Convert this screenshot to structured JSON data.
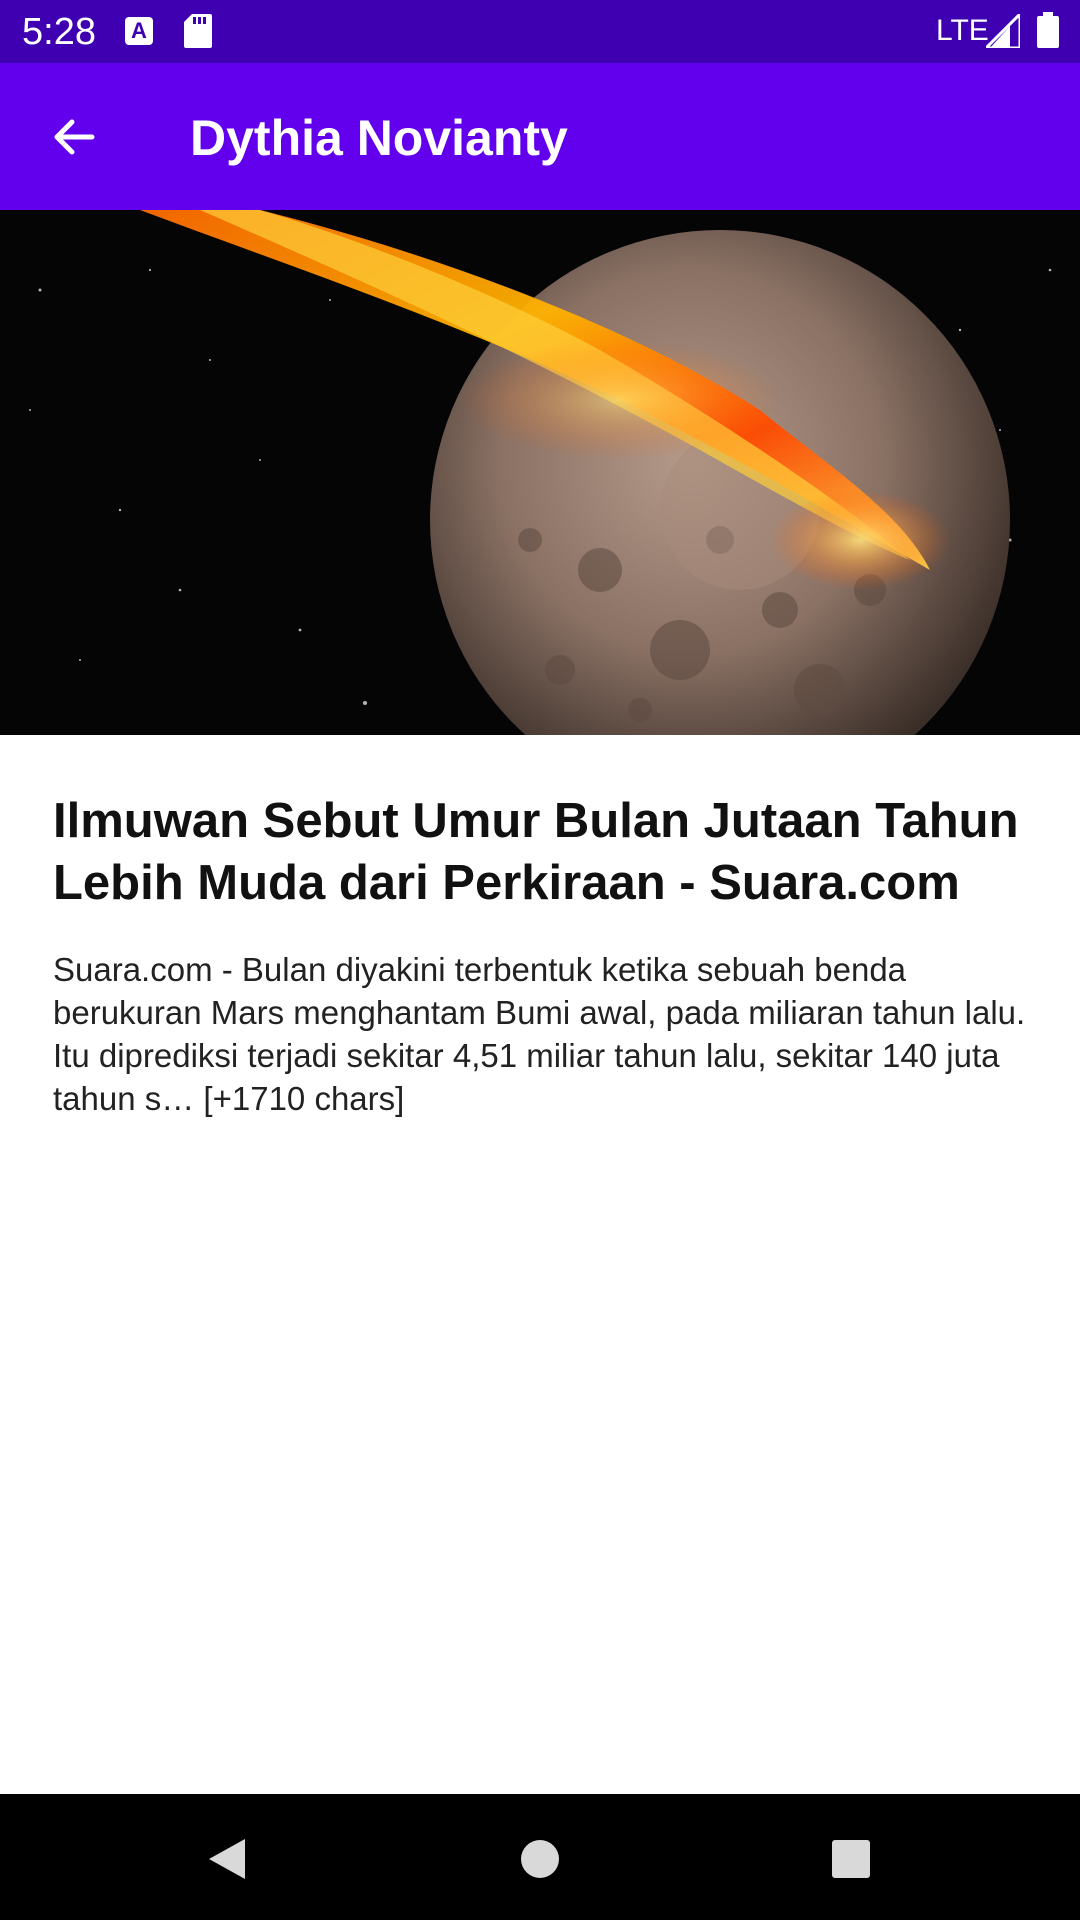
{
  "status_bar": {
    "time": "5:28",
    "network": "LTE",
    "icons": [
      "a-notification-icon",
      "sd-card-icon",
      "signal-icon",
      "battery-icon"
    ]
  },
  "app_bar": {
    "title": "Dythia Novianty",
    "back_icon": "arrow-back-icon",
    "color": "#6200ee"
  },
  "article": {
    "image_alt_icon": "moon-impact-image",
    "title": "Ilmuwan Sebut Umur Bulan Jutaan Tahun Lebih Muda dari Perkiraan - Suara.com",
    "description": "Suara.com - Bulan diyakini terbentuk ketika sebuah benda berukuran Mars menghantam Bumi awal, pada miliaran tahun lalu. Itu diprediksi terjadi sekitar 4,51 miliar tahun lalu, sekitar 140 juta tahun s… [+1710 chars]"
  },
  "nav_bar": {
    "icons": [
      "back-triangle-icon",
      "home-circle-icon",
      "recents-square-icon"
    ]
  },
  "colors": {
    "status_bar": "#3f00b2",
    "app_bar": "#6200ee",
    "nav_bar": "#000000"
  }
}
